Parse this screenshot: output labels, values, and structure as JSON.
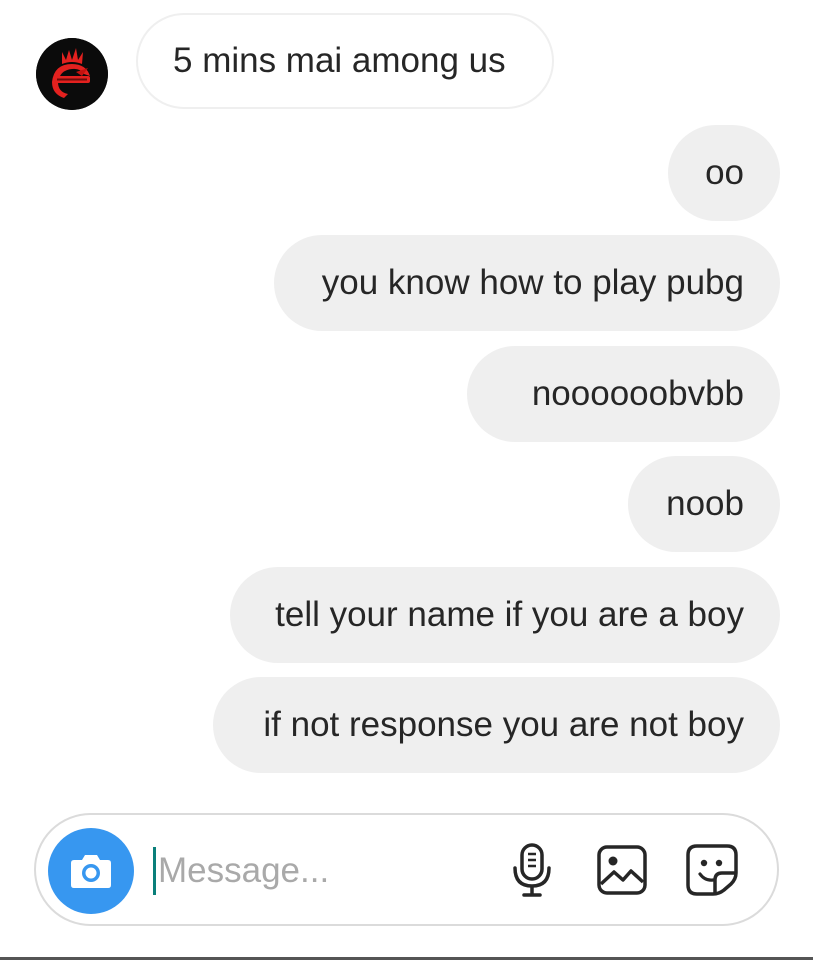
{
  "chat": {
    "incoming": [
      {
        "text": "5 mins mai among us"
      }
    ],
    "outgoing": [
      {
        "text": "oo"
      },
      {
        "text": "you know how to play pubg"
      },
      {
        "text": "noooooobvbb"
      },
      {
        "text": "noob"
      },
      {
        "text": "tell your name if you are a boy"
      },
      {
        "text": "if not response you are not boy"
      }
    ]
  },
  "composer": {
    "placeholder": "Message...",
    "value": "",
    "icons": [
      "camera-icon",
      "microphone-icon",
      "gallery-icon",
      "sticker-icon"
    ]
  },
  "colors": {
    "accent": "#3797f0",
    "bubble_out_bg": "#efefef",
    "bubble_in_border": "#efefef",
    "text": "#262626",
    "placeholder": "#a9a9a9",
    "caret": "#0a7f7a",
    "avatar_bg": "#0b0b0b",
    "avatar_mark": "#e3211f"
  }
}
